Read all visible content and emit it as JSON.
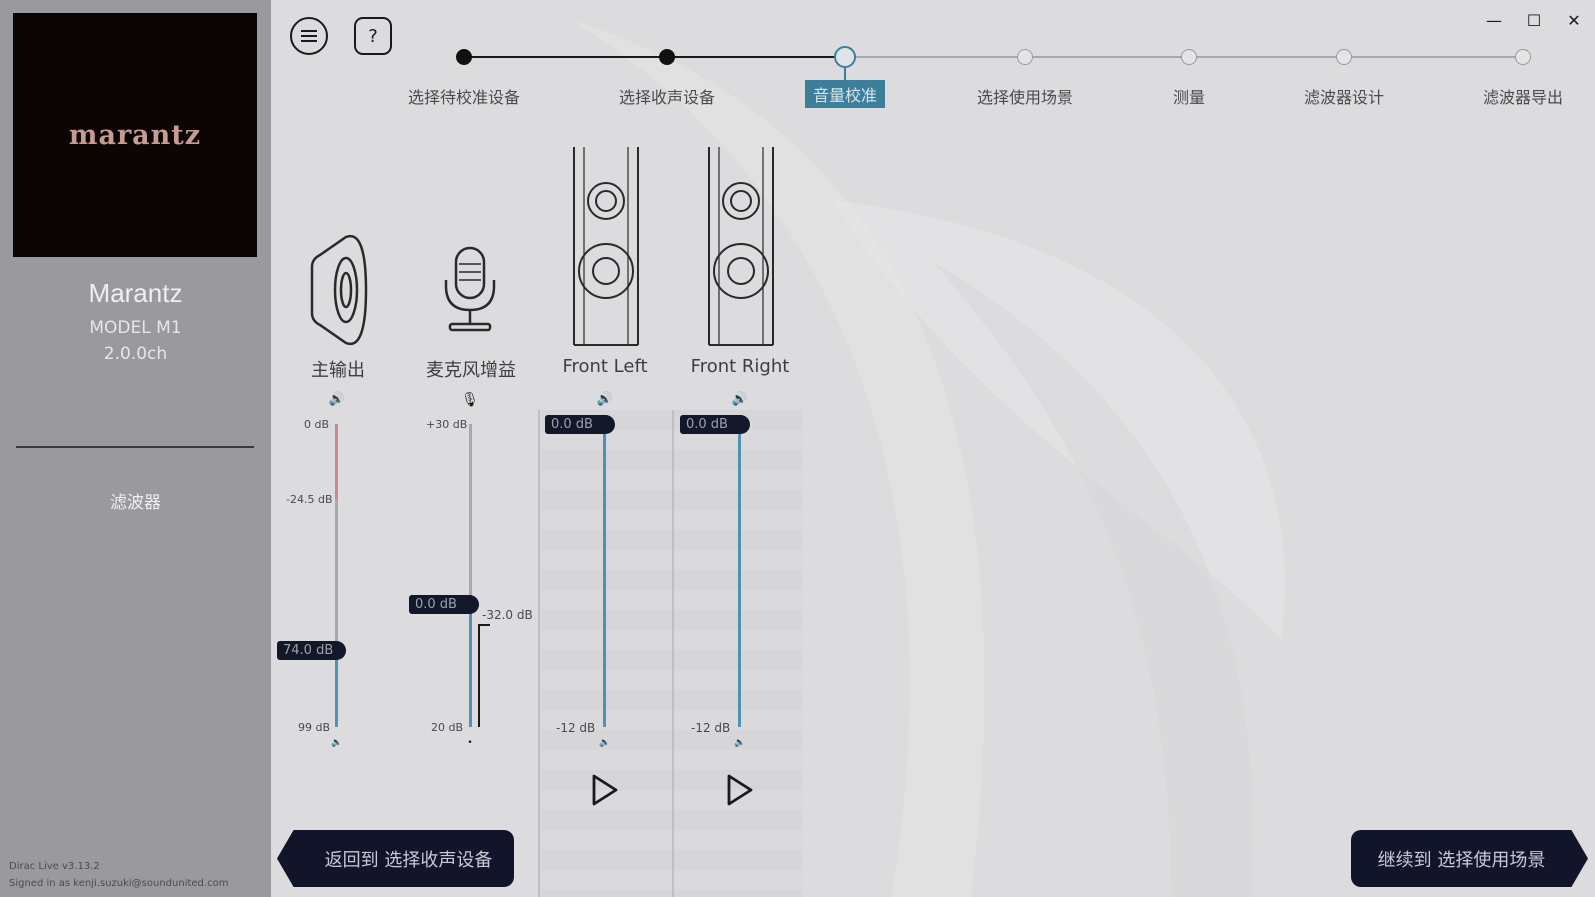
{
  "sidebar": {
    "logo_text": "marantz",
    "device_name": "Marantz",
    "device_model": "MODEL M1",
    "device_channels": "2.0.0ch",
    "filter_link": "滤波器",
    "version": "Dirac Live v3.13.2",
    "signed_in": "Signed in as kenji.suzuki@soundunited.com"
  },
  "toolbar": {
    "menu_icon": "hamburger-menu-icon",
    "help_label": "?"
  },
  "window_controls": {
    "minimize": "—",
    "maximize": "☐",
    "close": "✕"
  },
  "stepper": {
    "steps": [
      {
        "label": "选择待校准设备",
        "state": "done"
      },
      {
        "label": "选择收声设备",
        "state": "done"
      },
      {
        "label": "音量校准",
        "state": "active"
      },
      {
        "label": "选择使用场景",
        "state": "todo"
      },
      {
        "label": "测量",
        "state": "todo"
      },
      {
        "label": "滤波器设计",
        "state": "todo"
      },
      {
        "label": "滤波器导出"
      }
    ]
  },
  "channels": {
    "main_output": {
      "label": "主输出",
      "top_tick": "0 dB",
      "mid_tick": "-24.5 dB",
      "bottom_tick": "99 dB",
      "value": "74.0 dB",
      "level_fraction": 0.74
    },
    "mic_gain": {
      "label": "麦克风增益",
      "top_tick": "+30 dB",
      "bottom_tick": "20 dB",
      "value": "0.0 dB",
      "meter_reading": "-32.0 dB",
      "level_fraction": 0.6
    },
    "front_left": {
      "label": "Front Left",
      "value": "0.0 dB",
      "bottom_tick": "-12 dB",
      "level_fraction": 1.0
    },
    "front_right": {
      "label": "Front Right",
      "value": "0.0 dB",
      "bottom_tick": "-12 dB",
      "level_fraction": 1.0
    }
  },
  "icons": {
    "speaker": "speaker-volume-icon",
    "mic": "microphone-icon",
    "play": "play-icon"
  },
  "colors": {
    "accent": "#3d7e9a",
    "dark": "#12152a",
    "warning": "#c8898d",
    "slider_blue": "#4d93b3"
  },
  "nav": {
    "back_label": "返回到 选择收声设备",
    "next_label": "继续到 选择使用场景"
  }
}
